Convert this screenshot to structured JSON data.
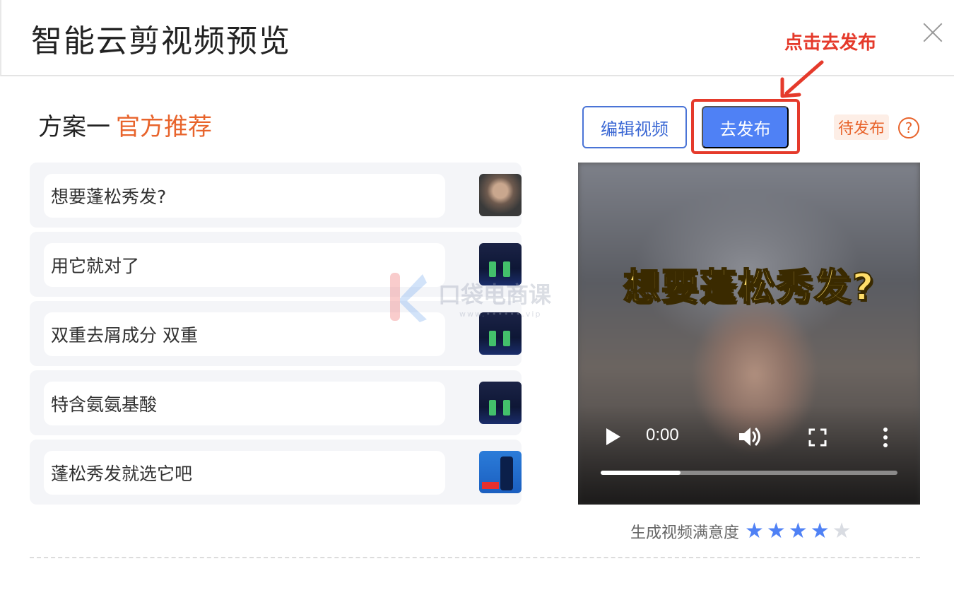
{
  "modal": {
    "title": "智能云剪视频预览",
    "close_icon": "close-icon"
  },
  "annotation": {
    "text": "点击去发布",
    "color": "#e53a2b"
  },
  "plan": {
    "label": "方案一",
    "tag": "官方推荐",
    "tag_color": "#e8642c"
  },
  "toolbar": {
    "edit_label": "编辑视频",
    "publish_label": "去发布",
    "status": "待发布",
    "help_glyph": "?"
  },
  "scripts": [
    {
      "text": "想要蓬松秀发?",
      "thumb": "portrait"
    },
    {
      "text": "用它就对了",
      "thumb": "product"
    },
    {
      "text": "双重去屑成分 双重",
      "thumb": "product"
    },
    {
      "text": "特含氨氨基酸",
      "thumb": "product"
    },
    {
      "text": "蓬松秀发就选它吧",
      "thumb": "bottle"
    }
  ],
  "watermark": {
    "text": "口袋电商课",
    "url": "www.••••••.vip"
  },
  "video": {
    "caption": "想要蓬松秀发?",
    "time": "0:00",
    "progress": 0.27,
    "controls": [
      "play-icon",
      "volume-icon",
      "fullscreen-icon",
      "more-icon"
    ]
  },
  "rating": {
    "label": "生成视频满意度",
    "value": 4,
    "max": 5,
    "on_color": "#4f81f5"
  },
  "colors": {
    "primary": "#4f81f5",
    "accent": "#e8642c"
  }
}
